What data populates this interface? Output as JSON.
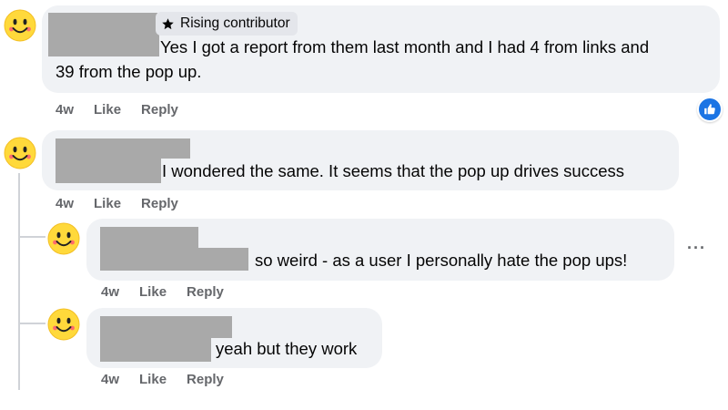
{
  "comments": [
    {
      "badge": "Rising contributor",
      "text_line1": "Yes I got a report from them last month and I had 4 from links and",
      "text_line2": "39 from the pop up.",
      "time": "4w",
      "like": "Like",
      "reply": "Reply",
      "reaction": "like-reaction-icon"
    },
    {
      "text": "I wondered the same. It seems that the pop up drives success",
      "time": "4w",
      "like": "Like",
      "reply": "Reply"
    },
    {
      "text": "so weird - as a user I personally hate the pop ups!",
      "time": "4w",
      "like": "Like",
      "reply": "Reply",
      "more": "···"
    },
    {
      "text": "yeah but they work",
      "time": "4w",
      "like": "Like",
      "reply": "Reply"
    }
  ],
  "icons": {
    "avatar": "smiley-avatar-icon",
    "badge": "star-icon",
    "reaction": "thumbs-up-icon"
  },
  "colors": {
    "bubble": "#f0f2f5",
    "redaction": "#a9a9a9",
    "reaction_blue": "#1b74e4",
    "meta_text": "#65676b"
  }
}
